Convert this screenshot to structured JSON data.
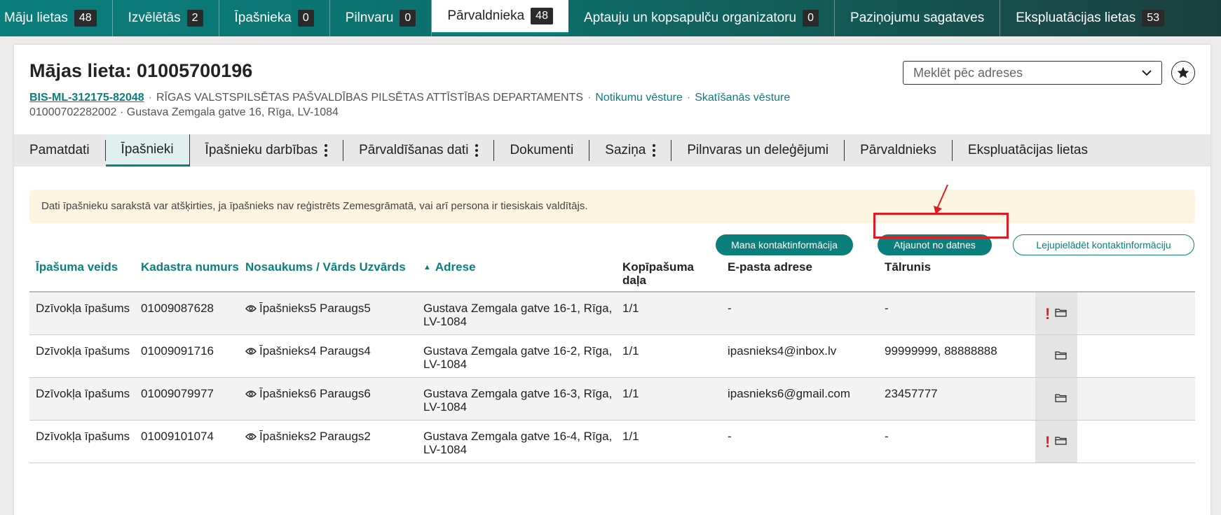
{
  "topnav": [
    {
      "label": "Māju lietas",
      "count": "48",
      "active": false
    },
    {
      "label": "Izvēlētās",
      "count": "2",
      "active": false
    },
    {
      "label": "Īpašnieka",
      "count": "0",
      "active": false
    },
    {
      "label": "Pilnvaru",
      "count": "0",
      "active": false
    },
    {
      "label": "Pārvaldnieka",
      "count": "48",
      "active": true
    },
    {
      "label": "Aptauju un kopsapulču organizatoru",
      "count": "0",
      "active": false
    },
    {
      "label": "Paziņojumu sagataves",
      "count": "",
      "active": false
    },
    {
      "label": "Ekspluatācijas lietas",
      "count": "53",
      "active": false
    }
  ],
  "header": {
    "title": "Mājas lieta: 01005700196",
    "case_code": "BIS-ML-312175-82048",
    "department": "RĪGAS VALSTSPILSĒTAS PAŠVALDĪBAS PILSĒTAS ATTĪSTĪBAS DEPARTAMENTS",
    "events_link": "Notikumu vēsture",
    "views_link": "Skatīšanās vēsture",
    "meta_line": "01000702282002 · Gustava Zemgala gatve 16, Rīga, LV-1084",
    "search_placeholder": "Meklēt pēc adreses",
    "separator": "·"
  },
  "tabs": [
    {
      "label": "Pamatdati",
      "menu": false
    },
    {
      "label": "Īpašnieki",
      "menu": false
    },
    {
      "label": "Īpašnieku darbības",
      "menu": true
    },
    {
      "label": "Pārvaldīšanas dati",
      "menu": true
    },
    {
      "label": "Dokumenti",
      "menu": false
    },
    {
      "label": "Saziņa",
      "menu": true
    },
    {
      "label": "Pilnvaras un deleģējumi",
      "menu": false
    },
    {
      "label": "Pārvaldnieks",
      "menu": false
    },
    {
      "label": "Ekspluatācijas lietas",
      "menu": false
    }
  ],
  "notice": "Dati īpašnieku sarakstā var atšķirties, ja īpašnieks nav reģistrēts Zemesgrāmatā, vai arī persona ir tiesiskais valdītājs.",
  "buttons": {
    "my_contacts": "Mana kontaktinformācija",
    "update_from_file": "Atjaunot no datnes",
    "download_contacts": "Lejupielādēt kontaktinformāciju"
  },
  "table": {
    "columns": {
      "type": "Īpašuma veids",
      "cadastre": "Kadastra numurs",
      "name": "Nosaukums / Vārds Uzvārds",
      "address": "Adrese",
      "share": "Kopīpašuma daļa",
      "email": "E-pasta adrese",
      "phone": "Tālrunis"
    },
    "rows": [
      {
        "type": "Dzīvokļa īpašums",
        "cadastre": "01009087628",
        "name": "Īpašnieks5 Paraugs5",
        "address": "Gustava Zemgala gatve 16-1, Rīga, LV-1084",
        "share": "1/1",
        "email": "-",
        "phone": "-",
        "warning": true
      },
      {
        "type": "Dzīvokļa īpašums",
        "cadastre": "01009091716",
        "name": "Īpašnieks4 Paraugs4",
        "address": "Gustava Zemgala gatve 16-2, Rīga, LV-1084",
        "share": "1/1",
        "email": "ipasnieks4@inbox.lv",
        "phone": "99999999, 88888888",
        "warning": false
      },
      {
        "type": "Dzīvokļa īpašums",
        "cadastre": "01009079977",
        "name": "Īpašnieks6 Paraugs6",
        "address": "Gustava Zemgala gatve 16-3, Rīga, LV-1084",
        "share": "1/1",
        "email": "ipasnieks6@gmail.com",
        "phone": "23457777",
        "warning": false
      },
      {
        "type": "Dzīvokļa īpašums",
        "cadastre": "01009101074",
        "name": "Īpašnieks2 Paraugs2",
        "address": "Gustava Zemgala gatve 16-4, Rīga, LV-1084",
        "share": "1/1",
        "email": "-",
        "phone": "-",
        "warning": true
      }
    ]
  },
  "colors": {
    "accent": "#0b7f7c",
    "highlight": "#e01b24",
    "notice_bg": "#fdf5df"
  }
}
